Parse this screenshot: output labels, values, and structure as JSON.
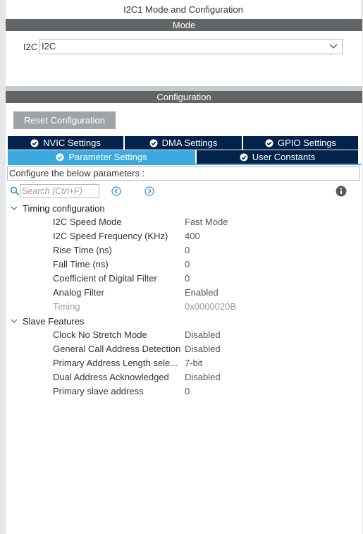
{
  "window": {
    "title": "I2C1 Mode and Configuration"
  },
  "mode": {
    "header": "Mode",
    "field_label": "I2C",
    "selected_value": "I2C"
  },
  "configuration": {
    "header": "Configuration",
    "reset_label": "Reset Configuration",
    "tabs_row1": [
      {
        "label": "NVIC Settings"
      },
      {
        "label": "DMA Settings"
      },
      {
        "label": "GPIO Settings"
      }
    ],
    "tabs_row2": [
      {
        "label": "Parameter Settings",
        "active": true
      },
      {
        "label": "User Constants"
      }
    ],
    "description": "Configure the below parameters :",
    "search_placeholder": "Search (Ctrl+F)",
    "groups": [
      {
        "name": "Timing configuration",
        "params": [
          {
            "name": "I2C Speed Mode",
            "value": "Fast Mode"
          },
          {
            "name": "I2C Speed Frequency (KHz)",
            "value": "400"
          },
          {
            "name": "Rise Time (ns)",
            "value": "0"
          },
          {
            "name": "Fall Time (ns)",
            "value": "0"
          },
          {
            "name": "Coefficient of Digital Filter",
            "value": "0"
          },
          {
            "name": "Analog Filter",
            "value": "Enabled"
          },
          {
            "name": "Timing",
            "value": "0x0000020B",
            "disabled": true
          }
        ]
      },
      {
        "name": "Slave Features",
        "params": [
          {
            "name": "Clock No Stretch Mode",
            "value": "Disabled"
          },
          {
            "name": "General Call Address Detection",
            "value": "Disabled"
          },
          {
            "name": "Primary Address Length sele...",
            "value": "7-bit"
          },
          {
            "name": "Dual Address Acknowledged",
            "value": "Disabled"
          },
          {
            "name": "Primary slave address",
            "value": "0"
          }
        ]
      }
    ]
  },
  "colors": {
    "section_bar": "#616568",
    "tab_dark": "#03234b",
    "tab_active": "#3ba9e0",
    "reset_button": "#a0a3a6"
  },
  "icons": {
    "search": "search-icon",
    "previous": "chevron-left-circle-icon",
    "next": "chevron-right-circle-icon",
    "info": "info-icon",
    "tab_check": "check-circle-icon",
    "group_expand": "chevron-down-icon",
    "dropdown": "chevron-down-icon"
  }
}
